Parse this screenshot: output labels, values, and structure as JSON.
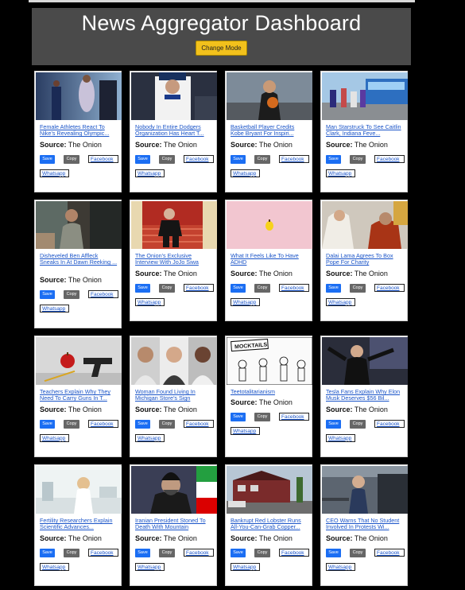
{
  "header": {
    "title": "News Aggregator Dashboard",
    "mode_button": "Change Mode"
  },
  "card_labels": {
    "source_label": "Source:",
    "save": "Save",
    "copy": "Copy",
    "facebook": "Facebook",
    "whatsapp": "Whatsapp"
  },
  "articles": [
    {
      "title": "Female Athletes React To Nike’s Revealing Olympic...",
      "source": "The Onion"
    },
    {
      "title": "Nobody In Entire Dodgers Organization Has Heart T...",
      "source": "The Onion"
    },
    {
      "title": "Basketball Player Credits Kobe Bryant For Inspiri...",
      "source": "The Onion"
    },
    {
      "title": "Man Starstruck To See Caitlin Clark, Indiana Feve...",
      "source": "The Onion"
    },
    {
      "title": "Disheveled Ben Affleck Sneaks In At Dawn Reeking ...",
      "source": "The Onion"
    },
    {
      "title": "The Onion’s Exclusive Interview With JoJo Siwa",
      "source": "The Onion"
    },
    {
      "title": "What It Feels Like To Have ADHD",
      "source": "The Onion"
    },
    {
      "title": "Dalai Lama Agrees To Box Pope For Charity",
      "source": "The Onion"
    },
    {
      "title": "Teachers Explain Why They Need To Carry Guns In T...",
      "source": "The Onion"
    },
    {
      "title": "Woman Found Living In Michigan Store’s Sign",
      "source": "The Onion"
    },
    {
      "title": "Teetotalitarianism",
      "source": "The Onion",
      "thumb_text": "MOCKTAILS"
    },
    {
      "title": "Tesla Fans Explain Why Elon Musk Deserves $56 Bil...",
      "source": "The Onion"
    },
    {
      "title": "Fertility Researchers Explain Scientific Advances...",
      "source": "The Onion"
    },
    {
      "title": "Iranian President Stoned To Death With Mountain",
      "source": "The Onion"
    },
    {
      "title": "Bankrupt Red Lobster Runs All-You-Can-Grab Copper...",
      "source": "The Onion"
    },
    {
      "title": "CEO Warns That No Student Involved In Protests Wi...",
      "source": "The Onion"
    }
  ]
}
